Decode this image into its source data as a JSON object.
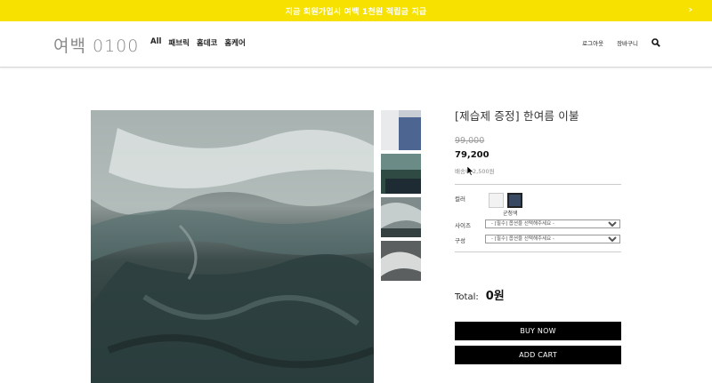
{
  "promo": {
    "text": "지금 회원가입시 여백 1천원 적립금 지급",
    "close_label": "›"
  },
  "header": {
    "logo": "여백 0100",
    "nav": [
      "All",
      "패브릭",
      "홈데코",
      "홈케어"
    ],
    "utility": {
      "logout": "로그아웃",
      "cart": "장바구니"
    }
  },
  "product": {
    "title": "[제습제 증정] 한여름 이불",
    "original_price": "99,000",
    "price": "79,200",
    "shipping": "배송비 2,500원",
    "options": {
      "color_label": "컬러",
      "color_selected": "군청색",
      "colors": [
        "#f2f2f2",
        "#3b4a63"
      ],
      "size_label": "사이즈",
      "size_placeholder": "- [필수] 옵션을 선택해주세요 -",
      "set_label": "구성",
      "set_placeholder": "- [필수] 옵션을 선택해주세요 -"
    },
    "total_label": "Total:",
    "total_value": "0원",
    "buy_label": "BUY NOW",
    "cart_label": "ADD CART"
  },
  "colors": {
    "promo_bg": "#f6e100",
    "button_bg": "#000000"
  }
}
